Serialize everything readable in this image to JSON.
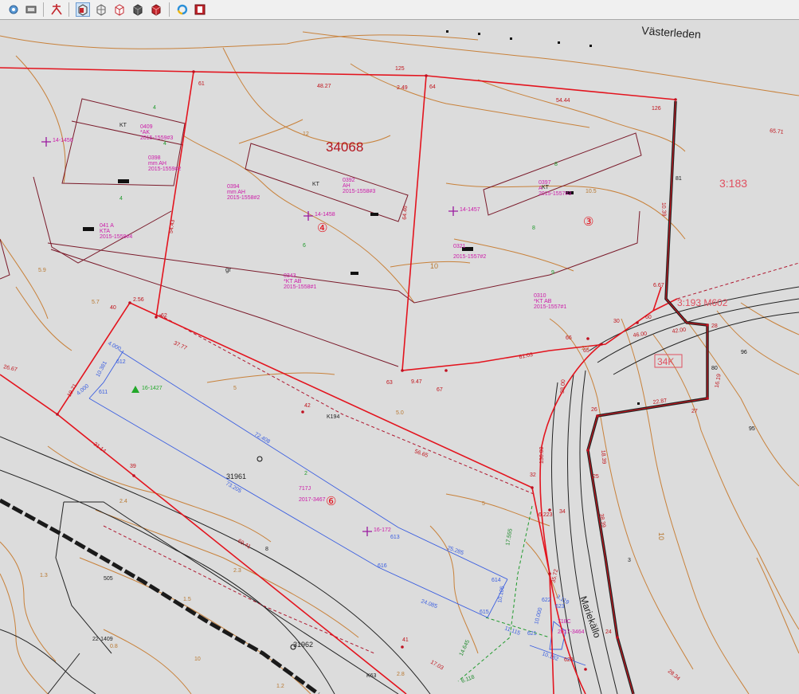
{
  "toolbar": {
    "tools": [
      "settings-cog",
      "layer",
      "snap",
      "view-3d-front",
      "view-3d-grid",
      "view-3d-box",
      "view-3d-filled",
      "view-3d-solid",
      "refresh",
      "export"
    ]
  },
  "colors": {
    "background": "#dcdcdc",
    "property_line": "#e3141e",
    "contour": "#c8813a",
    "blue_line": "#3a5ee0",
    "magenta_text": "#cc1aa8",
    "road_line": "#222222"
  },
  "map": {
    "road_name_vasterleden": "Västerleden",
    "road_name_mariekallo": "Mariekällo",
    "parcel_34068": "34068",
    "parcel_3183": "3:183",
    "parcel_3193": "3:193 M602",
    "zone_34k": "34K",
    "parcel_31961": "31961",
    "parcel_31962": "31962",
    "circle_4": "④",
    "circle_3": "③",
    "circle_6": "⑥",
    "kt_1": "KT",
    "kt_2": "KT",
    "kt_3": "KT",
    "k194": "K194",
    "k63": "K63",
    "label_0409": "0409",
    "label_ak": "*AK",
    "label_2015_1559_3": "2015-1559#3",
    "label_0398": "0398",
    "label_mm_ah_1": "mm AH",
    "label_2015_1559_2": "2015-1559#2",
    "label_0394": "0394",
    "label_mm_ah_2": "mm AH",
    "label_2015_1558_2": "2015-1558#2",
    "label_0392": "0392",
    "label_ah": "AH",
    "label_2015_1558_3": "2015-1558#3",
    "label_0397": "0397",
    "label_a": "A",
    "label_2015_1557_3": "2015-1557#3",
    "label_041a": "041 A",
    "label_kta_1": "KTA",
    "label_2015_1559_4": "2015-1559#4",
    "label_0321": "0321",
    "label_2015_1557_2": "2015-1557#2",
    "label_0343": "0343",
    "label_kt_ab_1": "*KT AB",
    "label_2015_1558_1": "2015-1558#1",
    "label_0310": "0310",
    "label_kt_ab_2": "*KT AB",
    "label_2015_1557_1": "2015-1557#1",
    "label_717j": "717J",
    "label_2017_3467": "2017-3467",
    "label_718c": "718C",
    "label_2017_3464": "2017-3464",
    "pt_14_1456": "14-1456",
    "pt_14_1458": "14-1458",
    "pt_14_1457": "14-1457",
    "pt_16_1427": "16-1427",
    "pt_16_172": "16-172",
    "pt_22_1409": "22-1409",
    "dim_48_27": "48.27",
    "dim_2_49": "2.49",
    "dim_54_44": "54.44",
    "dim_54_43": "54.43",
    "dim_64_46": "64.46",
    "dim_37_77": "37.77",
    "dim_61_03": "61.03",
    "dim_9_47": "9.47",
    "dim_56_65": "56.65",
    "dim_72_408": "72.408",
    "dim_73_205": "73.205",
    "dim_25_285": "25.285",
    "dim_24_085": "24.085",
    "dim_10_381": "10.381",
    "dim_4_000_a": "4.000",
    "dim_4_000_b": "4.000",
    "dim_19_71": "19.71",
    "dim_21_14": "21.14",
    "dim_26_67": "26.67",
    "dim_69_41": "69.41",
    "dim_17_555": "17.555",
    "dim_10_105": "10.105",
    "dim_11_115": "11.115",
    "dim_10_000": "10.000",
    "dim_10_182": "10.182",
    "dim_14_645": "14.645",
    "dim_6_118": "6.118",
    "dim_17_03": "17.03",
    "dim_38_00": "38.00",
    "dim_136_00": "136.00",
    "dim_35_72": "35.72",
    "dim_3_119": "3.119",
    "dim_6_223": "6.223",
    "dim_42_00": "42.00",
    "dim_46_00": "46.00",
    "dim_16_19": "16.19",
    "dim_22_87": "22.87",
    "dim_18_39": "18.39",
    "dim_65_71": "65.71",
    "dim_28_34": "28.34",
    "dim_10_39": "10.39",
    "dim_38_39": "38.39",
    "dim_2_56": "2.56",
    "dim_6_67": "6.67",
    "n_61": "61",
    "n_125": "125",
    "n_64": "64",
    "n_126": "126",
    "n_81": "81",
    "n_62": "62",
    "n_40": "40",
    "n_63": "63",
    "n_67": "67",
    "n_66": "66",
    "n_65": "65",
    "n_30": "30",
    "n_60": "60",
    "n_28": "28",
    "n_80": "80",
    "n_27": "27",
    "n_96": "96",
    "n_95": "95",
    "n_42": "42",
    "n_39": "39",
    "n_41": "41",
    "n_32": "32",
    "n_34": "34",
    "n_612": "612",
    "n_611": "611",
    "n_613": "613",
    "n_616": "616",
    "n_614": "614",
    "n_615": "615",
    "n_505": "505",
    "n_622": "622",
    "n_623": "623",
    "n_621": "621",
    "n_628": "628",
    "n_26": "26",
    "n_25": "25",
    "n_24": "24",
    "n_3": "3",
    "n_8": "8",
    "c_12": "12",
    "c_10a": "10",
    "c_10b": "10",
    "c_10c": "10",
    "c_59": "5.9",
    "c_57": "5.7",
    "c_5a": "5",
    "c_5b": "5.0",
    "c_5c": "5",
    "c_24": "2.4",
    "c_23": "2.3",
    "c_15": "1.5",
    "c_13": "1.3",
    "c_08": "0.8",
    "c_12b": "1.2",
    "c_28": "2.8",
    "c_27": "2.7",
    "c_105": "10.5",
    "gr": "gr",
    "g_4a": "4",
    "g_4b": "4",
    "g_4c": "4",
    "g_6": "6",
    "g_8a": "8",
    "g_8b": "8",
    "g_9": "9",
    "g_2": "2"
  }
}
